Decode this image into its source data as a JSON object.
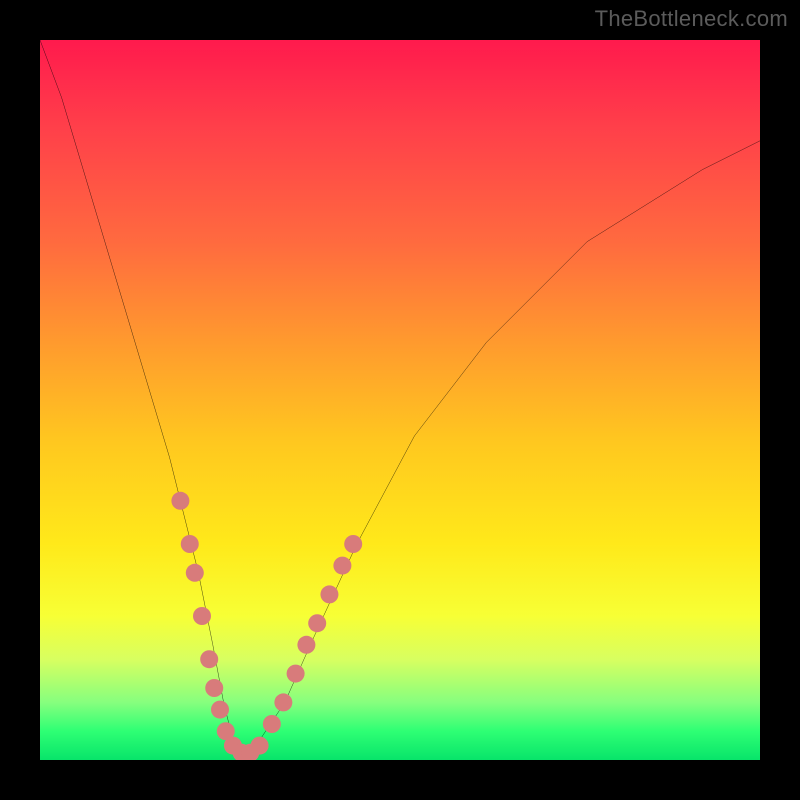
{
  "watermark": "TheBottleneck.com",
  "chart_data": {
    "type": "line",
    "title": "",
    "xlabel": "",
    "ylabel": "",
    "xlim": [
      0,
      100
    ],
    "ylim": [
      0,
      100
    ],
    "series": [
      {
        "name": "curve",
        "x": [
          0,
          3,
          6,
          9,
          12,
          15,
          18,
          20,
          22,
          24,
          25.5,
          27,
          28.5,
          30,
          34,
          38,
          44,
          52,
          62,
          76,
          92,
          100
        ],
        "y": [
          100,
          92,
          82,
          72,
          62,
          52,
          42,
          34,
          26,
          16,
          8,
          2,
          0,
          2,
          8,
          17,
          30,
          45,
          58,
          72,
          82,
          86
        ]
      }
    ],
    "markers": [
      {
        "name": "salmon-dots",
        "color": "#d87b7b",
        "points": [
          {
            "x": 19.5,
            "y": 36
          },
          {
            "x": 20.8,
            "y": 30
          },
          {
            "x": 21.5,
            "y": 26
          },
          {
            "x": 22.5,
            "y": 20
          },
          {
            "x": 23.5,
            "y": 14
          },
          {
            "x": 24.2,
            "y": 10
          },
          {
            "x": 25.0,
            "y": 7
          },
          {
            "x": 25.8,
            "y": 4
          },
          {
            "x": 26.8,
            "y": 2
          },
          {
            "x": 28.0,
            "y": 1
          },
          {
            "x": 29.2,
            "y": 1
          },
          {
            "x": 30.5,
            "y": 2
          },
          {
            "x": 32.2,
            "y": 5
          },
          {
            "x": 33.8,
            "y": 8
          },
          {
            "x": 35.5,
            "y": 12
          },
          {
            "x": 37.0,
            "y": 16
          },
          {
            "x": 38.5,
            "y": 19
          },
          {
            "x": 40.2,
            "y": 23
          },
          {
            "x": 42.0,
            "y": 27
          },
          {
            "x": 43.5,
            "y": 30
          }
        ]
      }
    ]
  }
}
